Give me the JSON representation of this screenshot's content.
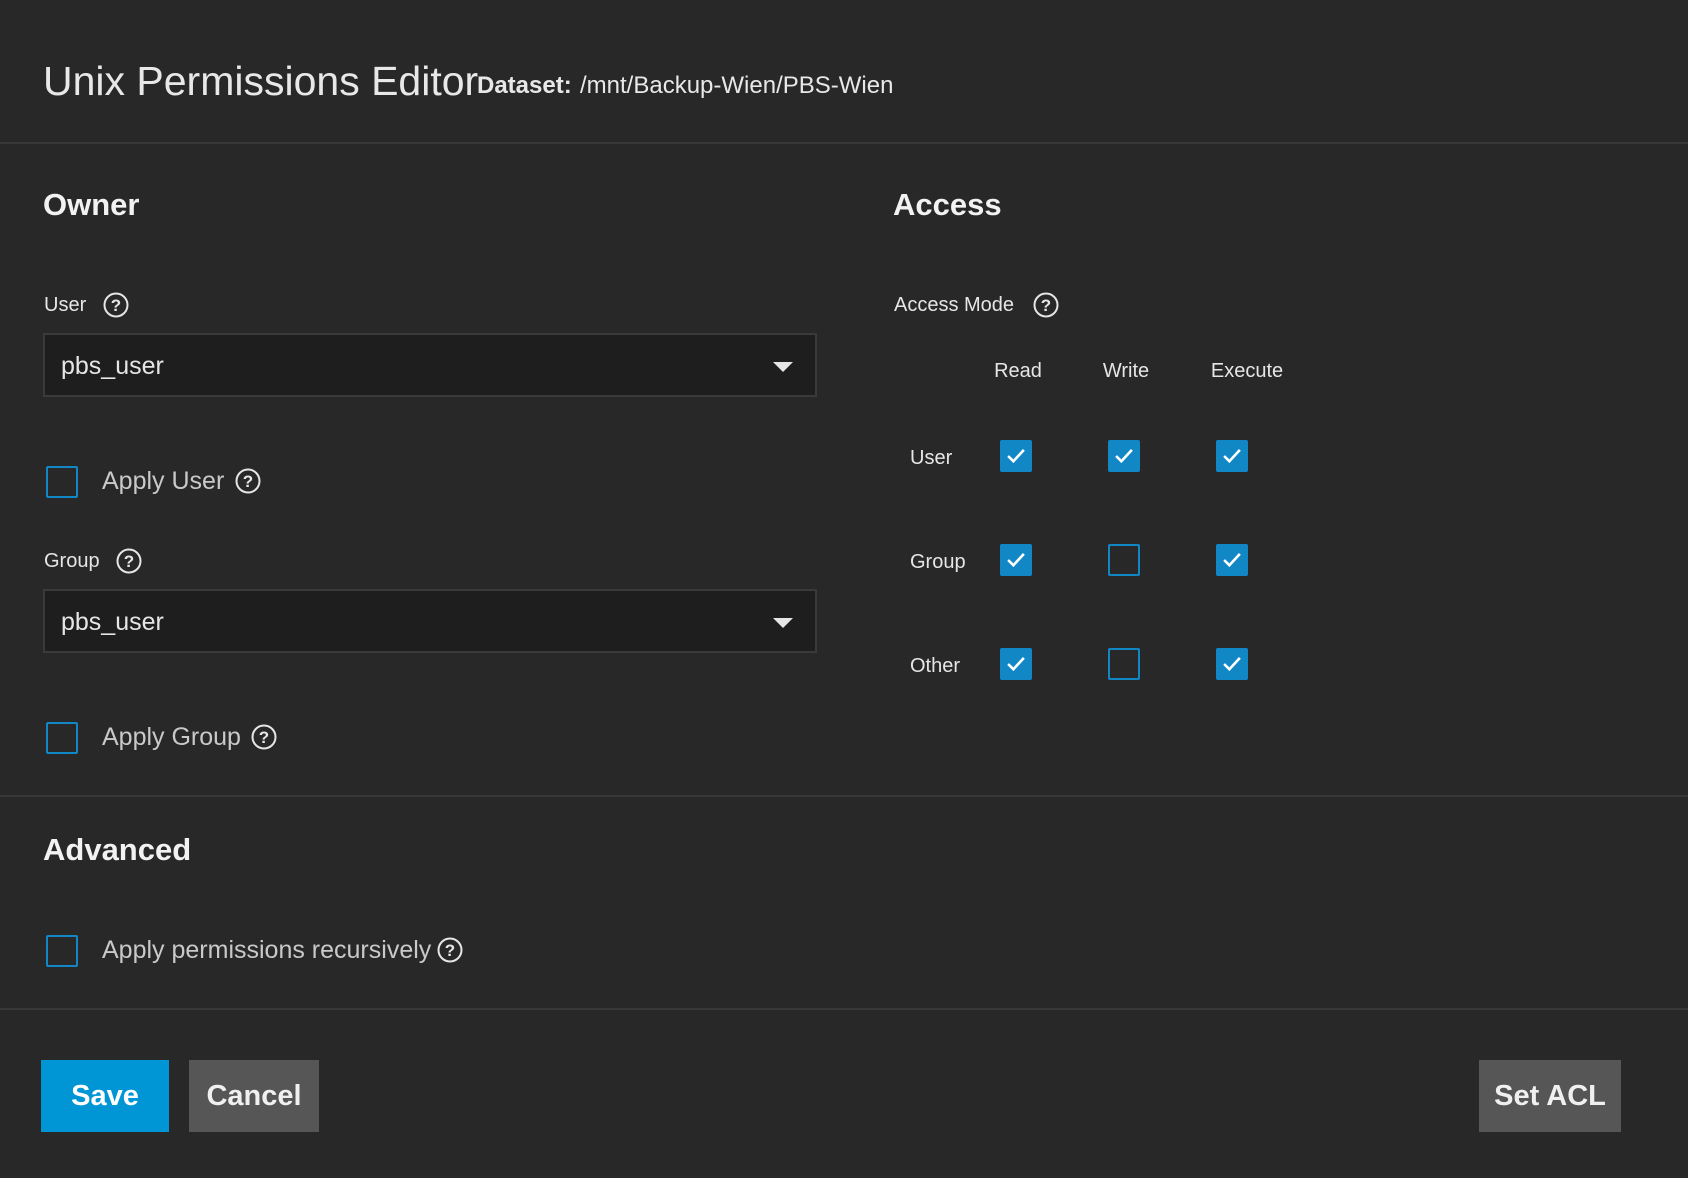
{
  "header": {
    "title": "Unix Permissions Editor",
    "dataset_label": "Dataset:",
    "dataset_path": "/mnt/Backup-Wien/PBS-Wien"
  },
  "owner": {
    "title": "Owner",
    "user_label": "User",
    "user_value": "pbs_user",
    "apply_user_label": "Apply User",
    "apply_user_checked": false,
    "group_label": "Group",
    "group_value": "pbs_user",
    "apply_group_label": "Apply Group",
    "apply_group_checked": false
  },
  "access": {
    "title": "Access",
    "mode_label": "Access Mode",
    "columns": [
      "Read",
      "Write",
      "Execute"
    ],
    "rows": [
      {
        "label": "User",
        "read": true,
        "write": true,
        "execute": true
      },
      {
        "label": "Group",
        "read": true,
        "write": false,
        "execute": true
      },
      {
        "label": "Other",
        "read": true,
        "write": false,
        "execute": true
      }
    ]
  },
  "advanced": {
    "title": "Advanced",
    "recursive_label": "Apply permissions recursively",
    "recursive_checked": false
  },
  "buttons": {
    "save": "Save",
    "cancel": "Cancel",
    "set_acl": "Set ACL"
  },
  "colors": {
    "accent": "#0095d5",
    "checkbox": "#1187c6",
    "background": "#282828"
  }
}
